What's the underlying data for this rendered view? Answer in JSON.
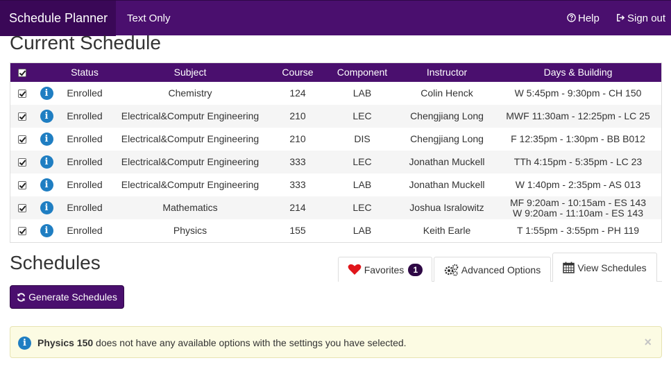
{
  "navbar": {
    "brand": "Schedule Planner",
    "text_only": "Text Only",
    "help": "Help",
    "sign_out": "Sign out"
  },
  "current_schedule": {
    "title": "Current Schedule",
    "columns": [
      "Status",
      "Subject",
      "Course",
      "Component",
      "Instructor",
      "Days & Building"
    ],
    "rows": [
      {
        "status": "Enrolled",
        "subject": "Chemistry",
        "course": "124",
        "component": "LAB",
        "instructor": "Colin Henck",
        "days": [
          "W 5:45pm - 9:30pm - CH 150"
        ]
      },
      {
        "status": "Enrolled",
        "subject": "Electrical&Computr Engineering",
        "course": "210",
        "component": "LEC",
        "instructor": "Chengjiang Long",
        "days": [
          "MWF 11:30am - 12:25pm - LC 25"
        ]
      },
      {
        "status": "Enrolled",
        "subject": "Electrical&Computr Engineering",
        "course": "210",
        "component": "DIS",
        "instructor": "Chengjiang Long",
        "days": [
          "F 12:35pm - 1:30pm - BB B012"
        ]
      },
      {
        "status": "Enrolled",
        "subject": "Electrical&Computr Engineering",
        "course": "333",
        "component": "LEC",
        "instructor": "Jonathan Muckell",
        "days": [
          "TTh 4:15pm - 5:35pm - LC 23"
        ]
      },
      {
        "status": "Enrolled",
        "subject": "Electrical&Computr Engineering",
        "course": "333",
        "component": "LAB",
        "instructor": "Jonathan Muckell",
        "days": [
          "W 1:40pm - 2:35pm - AS 013"
        ]
      },
      {
        "status": "Enrolled",
        "subject": "Mathematics",
        "course": "214",
        "component": "LEC",
        "instructor": "Joshua Isralowitz",
        "days": [
          "MF 9:20am - 10:15am - ES 143",
          "W 9:20am - 11:10am - ES 143"
        ]
      },
      {
        "status": "Enrolled",
        "subject": "Physics",
        "course": "155",
        "component": "LAB",
        "instructor": "Keith Earle",
        "days": [
          "T 1:55pm - 3:55pm - PH 119"
        ]
      }
    ]
  },
  "schedules": {
    "title": "Schedules",
    "generate_label": "Generate Schedules",
    "tabs": {
      "favorites": "Favorites",
      "favorites_count": "1",
      "advanced": "Advanced Options",
      "view": "View Schedules"
    }
  },
  "alert": {
    "strong": "Physics 150",
    "message": " does not have any available options with the settings you have selected.",
    "close": "×"
  },
  "colors": {
    "navbar": "#4a0f6e",
    "brand_bg": "#3a0857",
    "info_icon": "#1f7ec2",
    "alert_bg": "#fcfbe3",
    "heart": "#e0161b"
  }
}
